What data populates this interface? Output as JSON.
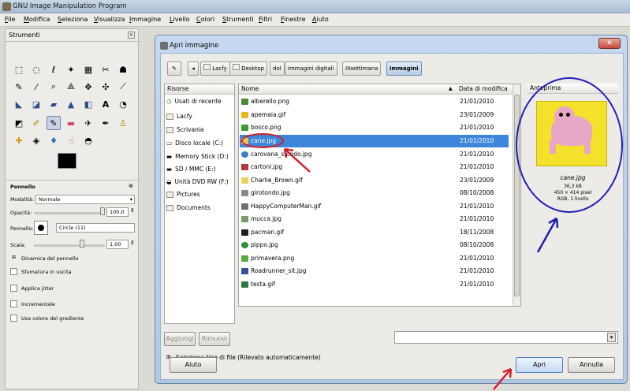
{
  "window": {
    "title": "GNU Image Manipulation Program"
  },
  "menu": {
    "items": [
      "File",
      "Modifica",
      "Seleziona",
      "Visualizza",
      "Immagine",
      "Livello",
      "Colori",
      "Strumenti",
      "Filtri",
      "Finestre",
      "Aiuto"
    ]
  },
  "toolbox": {
    "title": "Strumenti",
    "tool_options_title": "Pennello",
    "mode_label": "Modalità:",
    "mode_value": "Normale",
    "opacity_label": "Opacità:",
    "opacity_value": "100,0",
    "brush_label": "Pennello:",
    "brush_value": "Circle (11)",
    "scale_label": "Scala:",
    "scale_value": "1,00",
    "expander_label": "Dinamica del pennello",
    "checkboxes": [
      "Sfumatura in uscita",
      "Applica jitter",
      "Incrementale",
      "Usa colore del gradiente"
    ]
  },
  "dialog": {
    "title": "Apri immagine",
    "breadcrumb": [
      "Lacfy",
      "Desktop",
      "dol",
      "immagini digitali",
      "IIIsettimana",
      "immagini"
    ],
    "places_header": "Risorse",
    "places": [
      "Usati di recente",
      "Lacfy",
      "Scrivania",
      "Disco locale (C:)",
      "Memory Stick (D:)",
      "SD / MMC (E:)",
      "Unità DVD RW (F:)",
      "Pictures",
      "Documents"
    ],
    "columns": {
      "name": "Nome",
      "date": "Data di modifica"
    },
    "files": [
      {
        "name": "alberello.png",
        "date": "21/01/2010"
      },
      {
        "name": "apemaia.gif",
        "date": "23/01/2009"
      },
      {
        "name": "bosco.png",
        "date": "21/01/2010"
      },
      {
        "name": "cane.jpg",
        "date": "21/01/2010"
      },
      {
        "name": "carovana_sfondo.jpg",
        "date": "21/01/2010"
      },
      {
        "name": "cartoni.jpg",
        "date": "21/01/2010"
      },
      {
        "name": "Charlie_Brown.gif",
        "date": "23/01/2009"
      },
      {
        "name": "girotondo.jpg",
        "date": "08/10/2008"
      },
      {
        "name": "HappyComputerMan.gif",
        "date": "21/01/2010"
      },
      {
        "name": "mucca.jpg",
        "date": "21/01/2010"
      },
      {
        "name": "pacman.gif",
        "date": "18/11/2008"
      },
      {
        "name": "pippo.jpg",
        "date": "08/10/2008"
      },
      {
        "name": "primavera.png",
        "date": "21/01/2010"
      },
      {
        "name": "Roadrunner_sit.jpg",
        "date": "21/01/2010"
      },
      {
        "name": "testa.gif",
        "date": "21/01/2010"
      }
    ],
    "selected_file": "cane.jpg",
    "preview": {
      "header": "Anteprima",
      "filename": "cane.jpg",
      "size": "36,3 kB",
      "dims": "450 × 414 pixel",
      "mode": "RGB, 1 livello"
    },
    "add_button": "Aggiungi",
    "remove_button": "Rimuovi",
    "filetype_label": "Seleziona tipo di file (Rilevato automaticamente)",
    "help_button": "Aiuto",
    "open_button": "Apri",
    "cancel_button": "Annulla"
  },
  "colors": {
    "selection": "#3d86d9",
    "annotation_red": "#d0202a",
    "annotation_blue": "#1f1fb8"
  }
}
